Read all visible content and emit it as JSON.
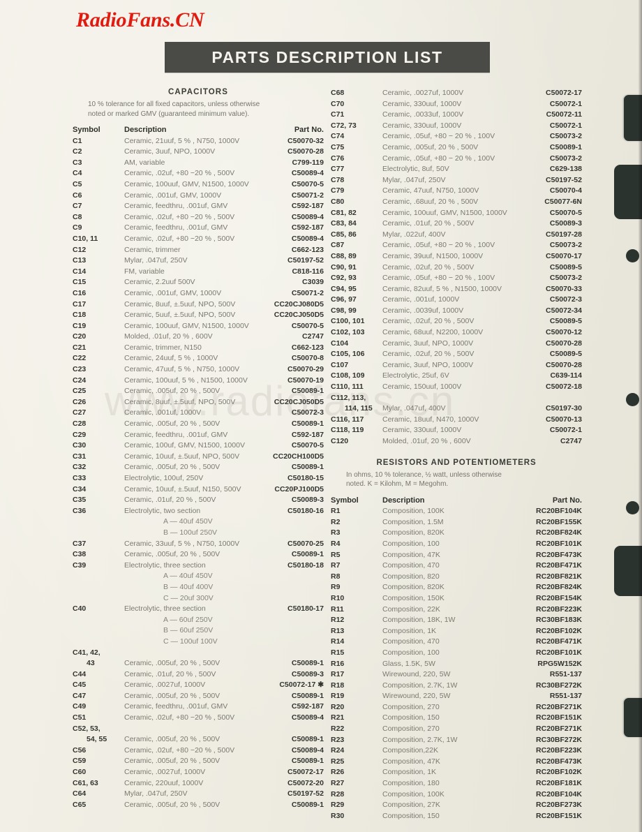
{
  "page": {
    "logo": "RadioFans.CN",
    "watermark": "www.radiofans.cn",
    "banner_title": "PARTS DESCRIPTION LIST"
  },
  "capacitors": {
    "title": "CAPACITORS",
    "note_line1": "10 % tolerance for all fixed capacitors, unless otherwise",
    "note_line2": "noted or marked GMV (guaranteed minimum value).",
    "headers": {
      "symbol": "Symbol",
      "description": "Description",
      "part_no": "Part No."
    },
    "rows_left": [
      {
        "symbol": "C1",
        "description": "Ceramic, 21uuf, 5 % , N750, 1000V",
        "part_no": "C50070-32"
      },
      {
        "symbol": "C2",
        "description": "Ceramic, 3uuf, NPO, 1000V",
        "part_no": "C50070-28"
      },
      {
        "symbol": "C3",
        "description": "AM, variable",
        "part_no": "C799-119"
      },
      {
        "symbol": "C4",
        "description": "Ceramic, .02uf, +80 −20 % , 500V",
        "part_no": "C50089-4"
      },
      {
        "symbol": "C5",
        "description": "Ceramic, 100uuf, GMV, N1500, 1000V",
        "part_no": "C50070-5"
      },
      {
        "symbol": "C6",
        "description": "Ceramic, .001uf, GMV, 1000V",
        "part_no": "C50071-2"
      },
      {
        "symbol": "C7",
        "description": "Ceramic, feedthru, .001uf, GMV",
        "part_no": "C592-187"
      },
      {
        "symbol": "C8",
        "description": "Ceramic, .02uf, +80 −20 % , 500V",
        "part_no": "C50089-4"
      },
      {
        "symbol": "C9",
        "description": "Ceramic, feedthru, .001uf, GMV",
        "part_no": "C592-187"
      },
      {
        "symbol": "C10, 11",
        "description": "Ceramic, .02uf, +80 −20 % , 500V",
        "part_no": "C50089-4"
      },
      {
        "symbol": "C12",
        "description": "Ceramic, trimmer",
        "part_no": "C662-123"
      },
      {
        "symbol": "C13",
        "description": "Mylar, .047uf, 250V",
        "part_no": "C50197-52"
      },
      {
        "symbol": "C14",
        "description": "FM, variable",
        "part_no": "C818-116"
      },
      {
        "symbol": "C15",
        "description": "Ceramic, 2.2uuf 500V",
        "part_no": "C3039"
      },
      {
        "symbol": "C16",
        "description": "Ceramic, .001uf, GMV, 1000V",
        "part_no": "C50071-2"
      },
      {
        "symbol": "C17",
        "description": "Ceramic, 8uuf, ±.5uuf, NPO, 500V",
        "part_no": "CC20CJ080D5"
      },
      {
        "symbol": "C18",
        "description": "Ceramic, 5uuf, ±.5uuf, NPO, 500V",
        "part_no": "CC20CJ050D5"
      },
      {
        "symbol": "C19",
        "description": "Ceramic, 100uuf, GMV, N1500, 1000V",
        "part_no": "C50070-5"
      },
      {
        "symbol": "C20",
        "description": "Molded, .01uf, 20 % , 600V",
        "part_no": "C2747"
      },
      {
        "symbol": "C21",
        "description": "Ceramic, trimmer, N150",
        "part_no": "C662-123"
      },
      {
        "symbol": "C22",
        "description": "Ceramic, 24uuf, 5 % , 1000V",
        "part_no": "C50070-8"
      },
      {
        "symbol": "C23",
        "description": "Ceramic, 47uuf, 5 % , N750, 1000V",
        "part_no": "C50070-29"
      },
      {
        "symbol": "C24",
        "description": "Ceramic, 100uuf, 5 % , N1500, 1000V",
        "part_no": "C50070-19"
      },
      {
        "symbol": "C25",
        "description": "Ceramic, .005uf, 20 % , 500V",
        "part_no": "C50089-1"
      },
      {
        "symbol": "C26",
        "description": "Ceramic, 8uuf, ±.5uuf, NPO, 500V",
        "part_no": "CC20CJ050D5"
      },
      {
        "symbol": "C27",
        "description": "Ceramic, .001uf, 1000V",
        "part_no": "C50072-3"
      },
      {
        "symbol": "C28",
        "description": "Ceramic, .005uf, 20 % , 500V",
        "part_no": "C50089-1"
      },
      {
        "symbol": "C29",
        "description": "Ceramic, feedthru, .001uf, GMV",
        "part_no": "C592-187"
      },
      {
        "symbol": "C30",
        "description": "Ceramic, 100uf, GMV, N1500, 1000V",
        "part_no": "C50070-5"
      },
      {
        "symbol": "C31",
        "description": "Ceramic, 10uuf, ±.5uuf, NPO, 500V",
        "part_no": "CC20CH100D5"
      },
      {
        "symbol": "C32",
        "description": "Ceramic, .005uf, 20 % , 500V",
        "part_no": "C50089-1"
      },
      {
        "symbol": "C33",
        "description": "Electrolytic, 100uf, 250V",
        "part_no": "C50180-15"
      },
      {
        "symbol": "C34",
        "description": "Ceramic, 10uuf, ±.5uuf, N150, 500V",
        "part_no": "CC20PJ100D5"
      },
      {
        "symbol": "C35",
        "description": "Ceramic, .01uf, 20 % , 500V",
        "part_no": "C50089-3"
      },
      {
        "symbol": "C36",
        "description": "Electrolytic, two section",
        "part_no": "C50180-16"
      },
      {
        "symbol": "",
        "description": "A —  40uf   450V",
        "part_no": "",
        "sub": true
      },
      {
        "symbol": "",
        "description": "B — 100uf   250V",
        "part_no": "",
        "sub": true
      },
      {
        "symbol": "C37",
        "description": "Ceramic, 33uuf, 5 % , N750, 1000V",
        "part_no": "C50070-25"
      },
      {
        "symbol": "C38",
        "description": "Ceramic, .005uf, 20 % , 500V",
        "part_no": "C50089-1"
      },
      {
        "symbol": "C39",
        "description": "Electrolytic, three section",
        "part_no": "C50180-18"
      },
      {
        "symbol": "",
        "description": "A — 40uf   450V",
        "part_no": "",
        "sub": true
      },
      {
        "symbol": "",
        "description": "B — 40uf   400V",
        "part_no": "",
        "sub": true
      },
      {
        "symbol": "",
        "description": "C — 20uf   300V",
        "part_no": "",
        "sub": true
      },
      {
        "symbol": "C40",
        "description": "Electrolytic, three section",
        "part_no": "C50180-17"
      },
      {
        "symbol": "",
        "description": "A —  60uf   250V",
        "part_no": "",
        "sub": true
      },
      {
        "symbol": "",
        "description": "B —  60uf   250V",
        "part_no": "",
        "sub": true
      },
      {
        "symbol": "",
        "description": "C — 100uf   100V",
        "part_no": "",
        "sub": true
      },
      {
        "symbol": "C41, 42,",
        "description": "",
        "part_no": ""
      },
      {
        "symbol": "43",
        "description": "Ceramic, .005uf, 20 % , 500V",
        "part_no": "C50089-1",
        "indent": true
      },
      {
        "symbol": "C44",
        "description": "Ceramic, .01uf, 20 % , 500V",
        "part_no": "C50089-3"
      },
      {
        "symbol": "C45",
        "description": "Ceramic, .0027uf, 1000V",
        "part_no": "C50072-17 ✱"
      },
      {
        "symbol": "C47",
        "description": "Ceramic, .005uf, 20 % , 500V",
        "part_no": "C50089-1"
      },
      {
        "symbol": "C49",
        "description": "Ceramic, feedthru, .001uf, GMV",
        "part_no": "C592-187"
      },
      {
        "symbol": "C51",
        "description": "Ceramic, .02uf, +80 −20 % , 500V",
        "part_no": "C50089-4"
      },
      {
        "symbol": "C52, 53,",
        "description": "",
        "part_no": ""
      },
      {
        "symbol": "54, 55",
        "description": "Ceramic, .005uf, 20 % , 500V",
        "part_no": "C50089-1",
        "indent": true
      },
      {
        "symbol": "C56",
        "description": "Ceramic, .02uf, +80 −20 % , 500V",
        "part_no": "C50089-4"
      },
      {
        "symbol": "C59",
        "description": "Ceramic, .005uf, 20 % , 500V",
        "part_no": "C50089-1"
      },
      {
        "symbol": "C60",
        "description": "Ceramic, .0027uf, 1000V",
        "part_no": "C50072-17"
      },
      {
        "symbol": "C61, 63",
        "description": "Ceramic, 220uuf, 1000V",
        "part_no": "C50072-20"
      },
      {
        "symbol": "C64",
        "description": "Mylar, .047uf, 250V",
        "part_no": "C50197-52"
      },
      {
        "symbol": "C65",
        "description": "Ceramic, .005uf, 20 % , 500V",
        "part_no": "C50089-1"
      }
    ],
    "rows_right": [
      {
        "symbol": "C68",
        "description": "Ceramic, .0027uf, 1000V",
        "part_no": "C50072-17"
      },
      {
        "symbol": "C70",
        "description": "Ceramic, 330uuf, 1000V",
        "part_no": "C50072-1"
      },
      {
        "symbol": "C71",
        "description": "Ceramic, .0033uf, 1000V",
        "part_no": "C50072-11"
      },
      {
        "symbol": "C72, 73",
        "description": "Ceramic, 330uuf, 1000V",
        "part_no": "C50072-1"
      },
      {
        "symbol": "C74",
        "description": "Ceramic, .05uf, +80 − 20 % , 100V",
        "part_no": "C50073-2"
      },
      {
        "symbol": "C75",
        "description": "Ceramic, .005uf, 20 % , 500V",
        "part_no": "C50089-1"
      },
      {
        "symbol": "C76",
        "description": "Ceramic, .05uf, +80 − 20 % , 100V",
        "part_no": "C50073-2"
      },
      {
        "symbol": "C77",
        "description": "Electrolytic, 8uf, 50V",
        "part_no": "C629-138"
      },
      {
        "symbol": "C78",
        "description": "Mylar, .047uf, 250V",
        "part_no": "C50197-52"
      },
      {
        "symbol": "C79",
        "description": "Ceramic, 47uuf, N750, 1000V",
        "part_no": "C50070-4"
      },
      {
        "symbol": "C80",
        "description": "Ceramic, .68uuf, 20 % , 500V",
        "part_no": "C50077-6N"
      },
      {
        "symbol": "C81, 82",
        "description": "Ceramic, 100uuf, GMV, N1500, 1000V",
        "part_no": "C50070-5"
      },
      {
        "symbol": "C83, 84",
        "description": "Ceramic, .01uf, 20 % , 500V",
        "part_no": "C50089-3"
      },
      {
        "symbol": "C85, 86",
        "description": "Mylar, .022uf, 400V",
        "part_no": "C50197-28"
      },
      {
        "symbol": "C87",
        "description": "Ceramic, .05uf, +80 − 20 % , 100V",
        "part_no": "C50073-2"
      },
      {
        "symbol": "C88, 89",
        "description": "Ceramic, 39uuf, N1500, 1000V",
        "part_no": "C50070-17"
      },
      {
        "symbol": "C90, 91",
        "description": "Ceramic, .02uf, 20 % , 500V",
        "part_no": "C50089-5"
      },
      {
        "symbol": "C92, 93",
        "description": "Ceramic, .05uf, +80 − 20 % , 100V",
        "part_no": "C50073-2"
      },
      {
        "symbol": "C94, 95",
        "description": "Ceramic, 82uuf, 5 % , N1500, 1000V",
        "part_no": "C50070-33"
      },
      {
        "symbol": "C96, 97",
        "description": "Ceramic, .001uf, 1000V",
        "part_no": "C50072-3"
      },
      {
        "symbol": "C98, 99",
        "description": "Ceramic, .0039uf, 1000V",
        "part_no": "C50072-34"
      },
      {
        "symbol": "C100, 101",
        "description": "Ceramic, .02uf, 20 % , 500V",
        "part_no": "C50089-5"
      },
      {
        "symbol": "C102, 103",
        "description": "Ceramic, 68uuf, N2200, 1000V",
        "part_no": "C50070-12"
      },
      {
        "symbol": "C104",
        "description": "Ceramic, 3uuf, NPO, 1000V",
        "part_no": "C50070-28"
      },
      {
        "symbol": "C105, 106",
        "description": "Ceramic, .02uf, 20 % , 500V",
        "part_no": "C50089-5"
      },
      {
        "symbol": "C107",
        "description": "Ceramic, 3uuf, NPO, 1000V",
        "part_no": "C50070-28"
      },
      {
        "symbol": "C108, 109",
        "description": "Electrolytic, 25uf, 6V",
        "part_no": "C639-114"
      },
      {
        "symbol": "C110, 111",
        "description": "Ceramic, 150uuf, 1000V",
        "part_no": "C50072-18"
      },
      {
        "symbol": "C112, 113,",
        "description": "",
        "part_no": ""
      },
      {
        "symbol": "114, 115",
        "description": "Mylar, .047uf, 400V",
        "part_no": "C50197-30",
        "indent": true
      },
      {
        "symbol": "C116, 117",
        "description": "Ceramic, 18uuf, N470, 1000V",
        "part_no": "C50070-13"
      },
      {
        "symbol": "C118, 119",
        "description": "Ceramic, 330uuf, 1000V",
        "part_no": "C50072-1"
      },
      {
        "symbol": "C120",
        "description": "Molded, .01uf, 20 % , 600V",
        "part_no": "C2747"
      }
    ]
  },
  "resistors": {
    "title": "RESISTORS AND POTENTIOMETERS",
    "note_line1": "In ohms, 10 % tolerance, ½ watt, unless otherwise",
    "note_line2": "noted.  K = Kilohm, M = Megohm.",
    "headers": {
      "symbol": "Symbol",
      "description": "Description",
      "part_no": "Part No."
    },
    "rows": [
      {
        "symbol": "R1",
        "description": "Composition, 100K",
        "part_no": "RC20BF104K"
      },
      {
        "symbol": "R2",
        "description": "Composition, 1.5M",
        "part_no": "RC20BF155K"
      },
      {
        "symbol": "R3",
        "description": "Composition, 820K",
        "part_no": "RC20BF824K"
      },
      {
        "symbol": "R4",
        "description": "Composition, 100",
        "part_no": "RC20BF101K"
      },
      {
        "symbol": "R5",
        "description": "Composition, 47K",
        "part_no": "RC20BF473K"
      },
      {
        "symbol": "R7",
        "description": "Composition, 470",
        "part_no": "RC20BF471K"
      },
      {
        "symbol": "R8",
        "description": "Composition, 820",
        "part_no": "RC20BF821K"
      },
      {
        "symbol": "R9",
        "description": "Composition, 820K",
        "part_no": "RC20BF824K"
      },
      {
        "symbol": "R10",
        "description": "Composition, 150K",
        "part_no": "RC20BF154K"
      },
      {
        "symbol": "R11",
        "description": "Composition, 22K",
        "part_no": "RC20BF223K"
      },
      {
        "symbol": "R12",
        "description": "Composition, 18K, 1W",
        "part_no": "RC30BF183K"
      },
      {
        "symbol": "R13",
        "description": "Composition, 1K",
        "part_no": "RC20BF102K"
      },
      {
        "symbol": "R14",
        "description": "Composition, 470",
        "part_no": "RC20BF471K"
      },
      {
        "symbol": "R15",
        "description": "Composition, 100",
        "part_no": "RC20BF101K"
      },
      {
        "symbol": "R16",
        "description": "Glass, 1.5K, 5W",
        "part_no": "RPG5W152K"
      },
      {
        "symbol": "R17",
        "description": "Wirewound, 220, 5W",
        "part_no": "R551-137"
      },
      {
        "symbol": "R18",
        "description": "Composition, 2.7K, 1W",
        "part_no": "RC30BF272K"
      },
      {
        "symbol": "R19",
        "description": "Wirewound, 220, 5W",
        "part_no": "R551-137"
      },
      {
        "symbol": "R20",
        "description": "Composition, 270",
        "part_no": "RC20BF271K"
      },
      {
        "symbol": "R21",
        "description": "Composition, 150",
        "part_no": "RC20BF151K"
      },
      {
        "symbol": "R22",
        "description": "Composition, 270",
        "part_no": "RC20BF271K"
      },
      {
        "symbol": "R23",
        "description": "Composition, 2.7K, 1W",
        "part_no": "RC30BF272K"
      },
      {
        "symbol": "R24",
        "description": "Composition,22K",
        "part_no": "RC20BF223K"
      },
      {
        "symbol": "R25",
        "description": "Composition, 47K",
        "part_no": "RC20BF473K"
      },
      {
        "symbol": "R26",
        "description": "Composition, 1K",
        "part_no": "RC20BF102K"
      },
      {
        "symbol": "R27",
        "description": "Composition, 180",
        "part_no": "RC20BF181K"
      },
      {
        "symbol": "R28",
        "description": "Composition, 100K",
        "part_no": "RC20BF104K"
      },
      {
        "symbol": "R29",
        "description": "Composition, 27K",
        "part_no": "RC20BF273K"
      },
      {
        "symbol": "R30",
        "description": "Composition, 150",
        "part_no": "RC20BF151K"
      }
    ]
  }
}
